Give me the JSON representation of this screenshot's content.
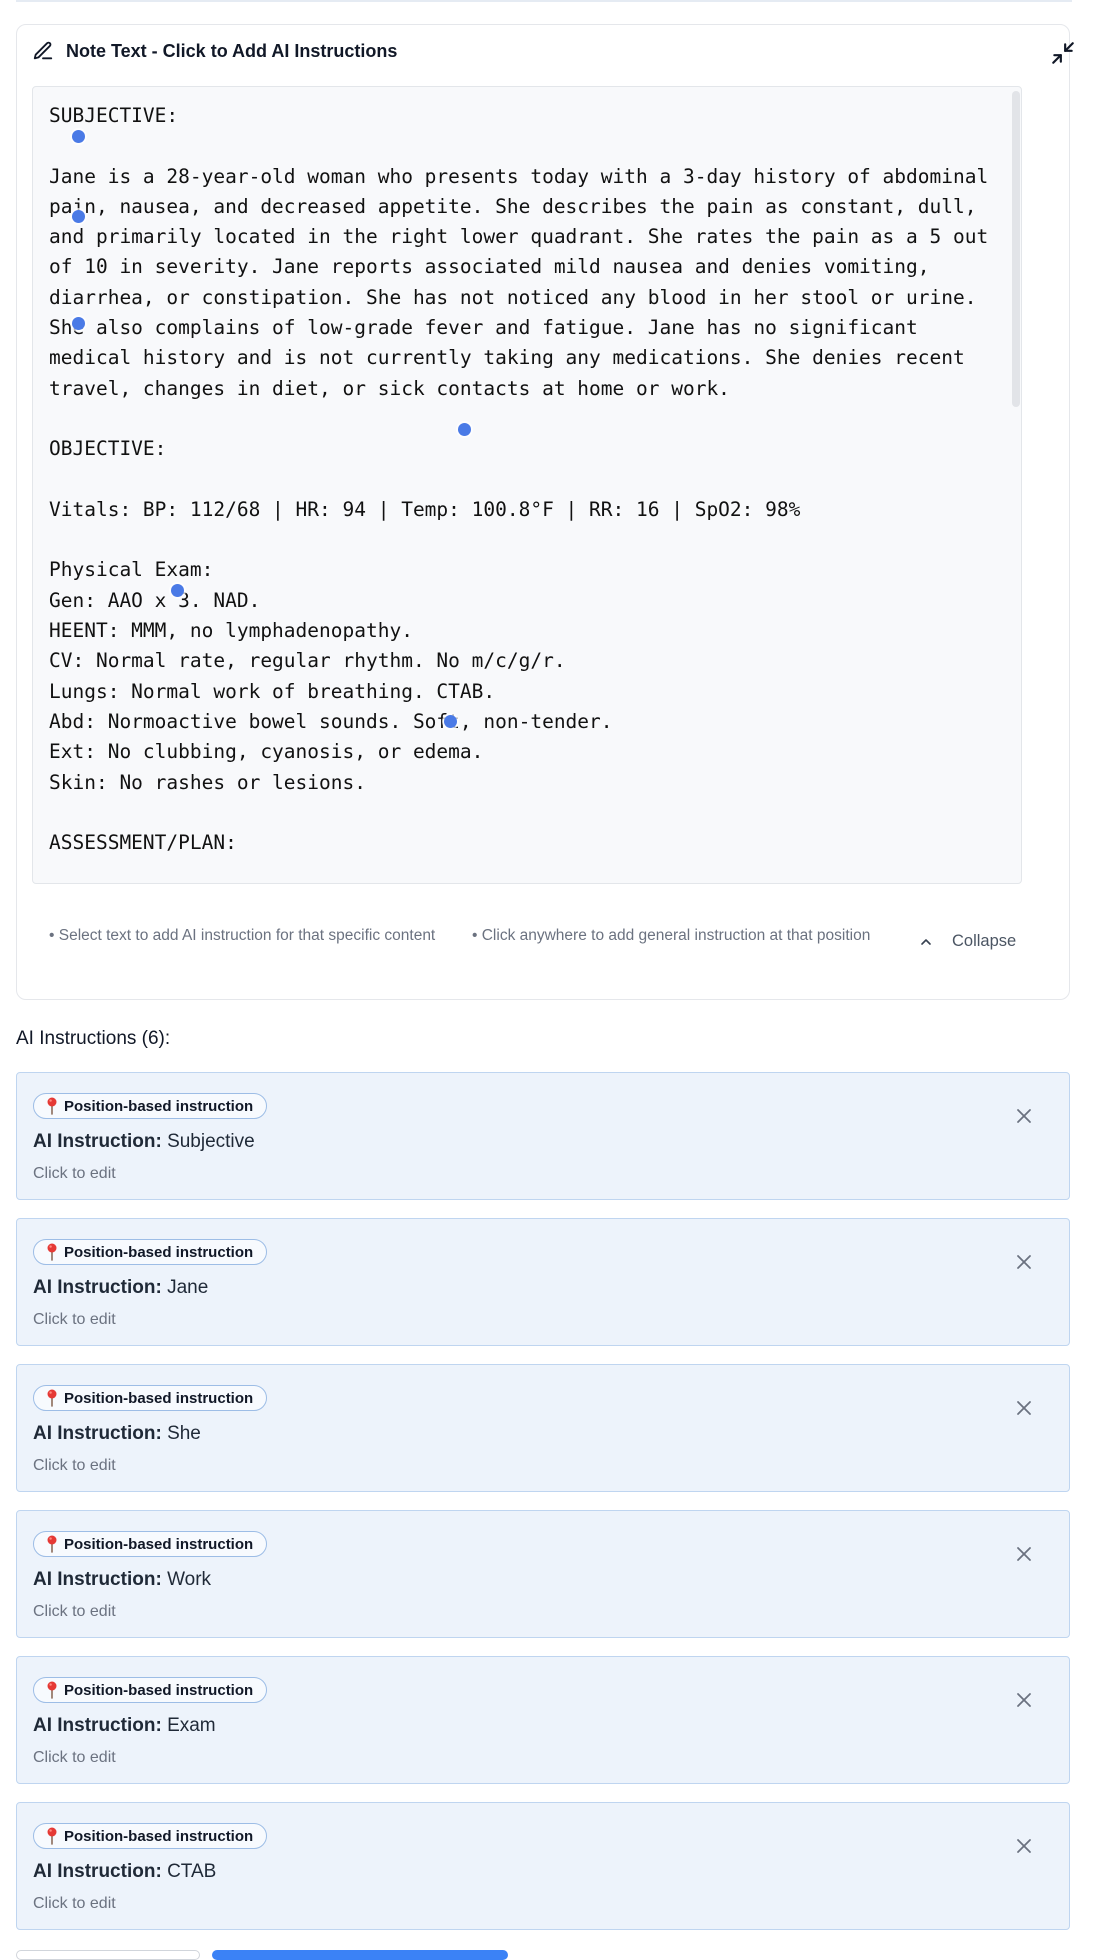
{
  "note": {
    "title": "Note Text - Click to Add AI Instructions",
    "text": "SUBJECTIVE:\n\nJane is a 28-year-old woman who presents today with a 3-day history of abdominal pain, nausea, and decreased appetite. She describes the pain as constant, dull, and primarily located in the right lower quadrant. She rates the pain as a 5 out of 10 in severity. Jane reports associated mild nausea and denies vomiting, diarrhea, or constipation. She has not noticed any blood in her stool or urine. She also complains of low-grade fever and fatigue. Jane has no significant medical history and is not currently taking any medications. She denies recent travel, changes in diet, or sick contacts at home or work.\n\nOBJECTIVE:\n\nVitals: BP: 112/68 | HR: 94 | Temp: 100.8°F | RR: 16 | SpO2: 98%\n\nPhysical Exam:\nGen: AAO x 3. NAD.\nHEENT: MMM, no lymphadenopathy.\nCV: Normal rate, regular rhythm. No m/c/g/r.\nLungs: Normal work of breathing. CTAB.\nAbd: Normoactive bowel sounds. Soft, non-tender.\nExt: No clubbing, cyanosis, or edema.\nSkin: No rashes or lesions.\n\nASSESSMENT/PLAN:",
    "hint_select": "• Select text to add AI instruction for that specific content",
    "hint_click": "• Click anywhere to add general instruction at that position",
    "collapse_label": "Collapse"
  },
  "instructions": {
    "heading": "AI Instructions (6):",
    "badge_label": "Position-based instruction",
    "prefix": "AI Instruction:",
    "edit_hint": "Click to edit",
    "items": [
      {
        "target": "Subjective"
      },
      {
        "target": "Jane"
      },
      {
        "target": "She"
      },
      {
        "target": "Work"
      },
      {
        "target": "Exam"
      },
      {
        "target": "CTAB"
      }
    ]
  },
  "colors": {
    "accent": "#4a7ae6",
    "card_bg": "#edf3fb",
    "card_border": "#bfd5f0"
  },
  "icons": {
    "header": "pencil-icon",
    "collapse": "minimize-icon",
    "pin": "pushpin-icon",
    "close": "close-icon",
    "chevron": "chevron-up-icon"
  }
}
